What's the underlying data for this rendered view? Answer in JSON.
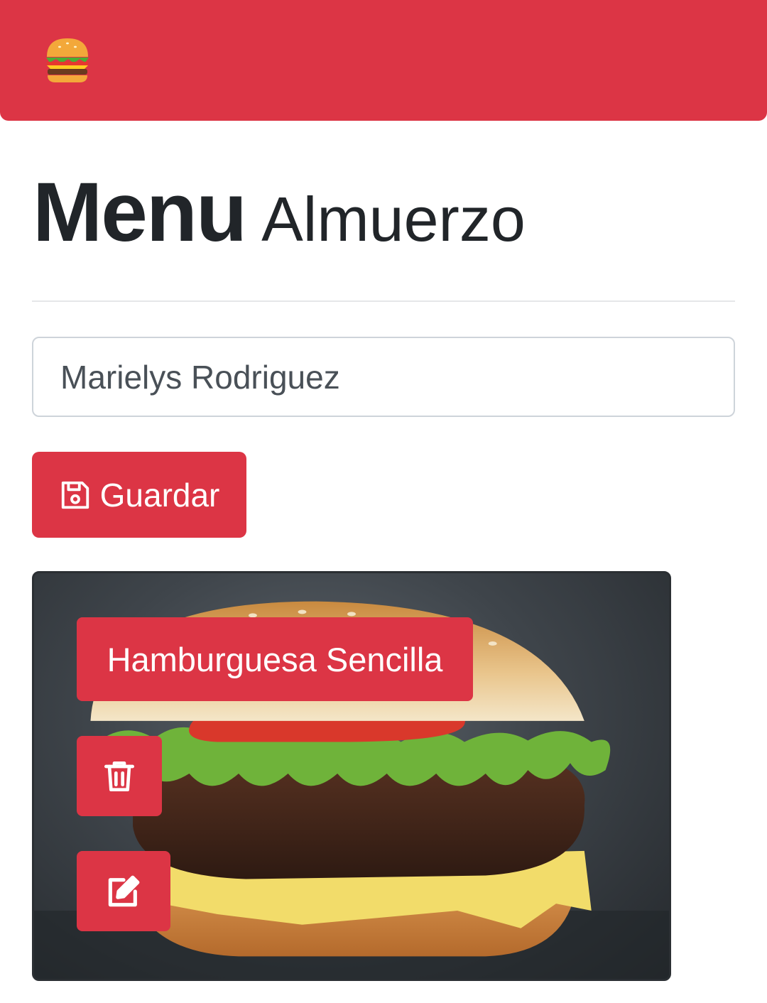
{
  "navbar": {
    "logo_icon": "burger-icon",
    "color": "#dc3545"
  },
  "header": {
    "title": "Menu",
    "subtitle": "Almuerzo"
  },
  "form": {
    "name_value": "Marielys Rodriguez",
    "save_label": "Guardar",
    "save_icon": "floppy-disk-icon"
  },
  "menu_items": [
    {
      "name": "Hamburguesa Sencilla",
      "image": "burger-photo",
      "delete_icon": "trash-icon",
      "edit_icon": "edit-icon"
    }
  ],
  "colors": {
    "accent": "#dc3545",
    "text": "#212529",
    "input_border": "#ced4da"
  }
}
